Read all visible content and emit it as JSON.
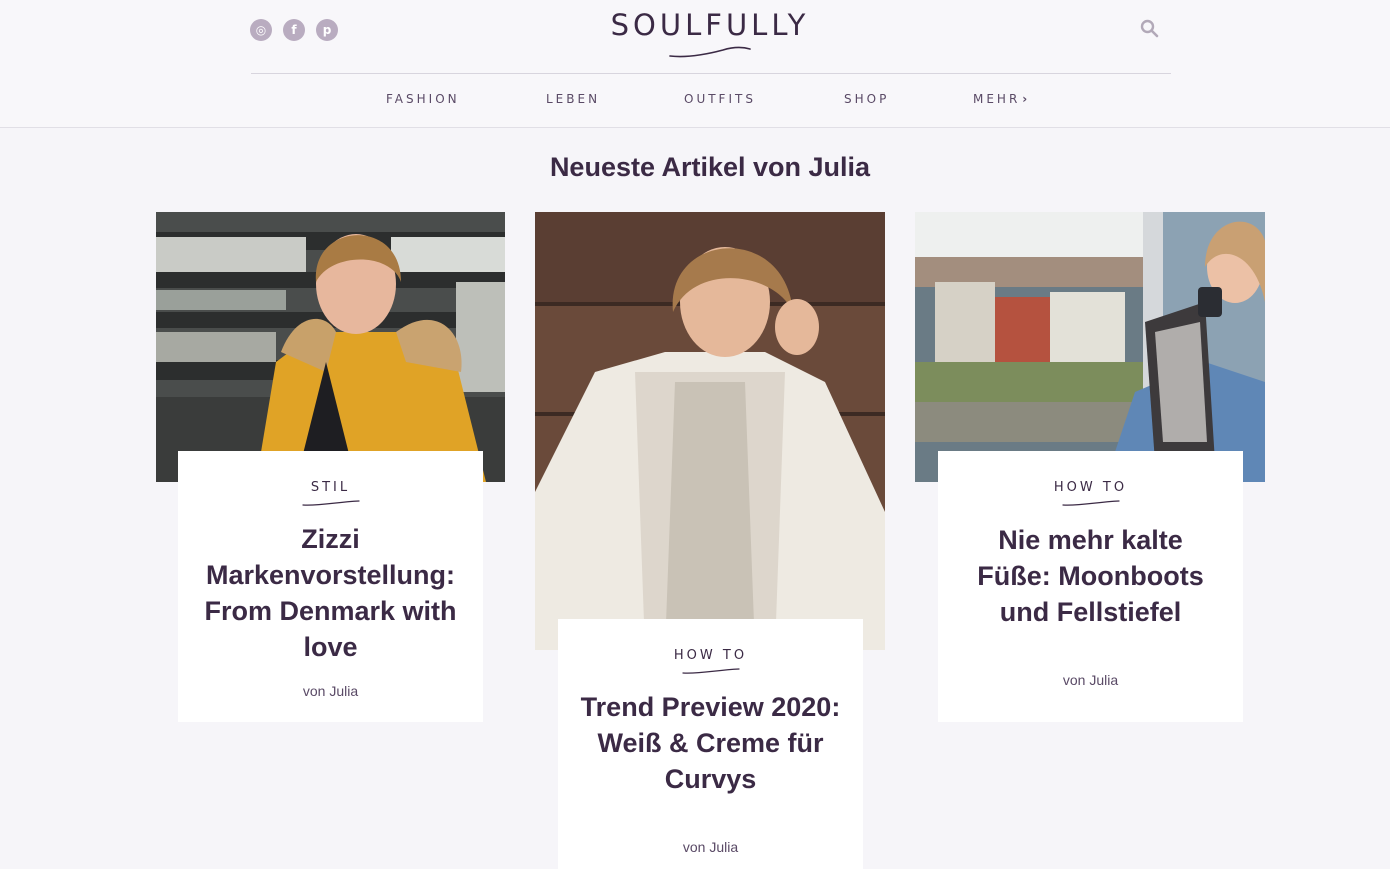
{
  "header": {
    "logo": "SOULFULLY",
    "social": [
      {
        "icon": "instagram-icon",
        "glyph": "◎"
      },
      {
        "icon": "facebook-icon",
        "glyph": "f"
      },
      {
        "icon": "pinterest-icon",
        "glyph": "p"
      }
    ],
    "search_icon": "search-icon"
  },
  "nav": {
    "items": [
      "FASHION",
      "LEBEN",
      "OUTFITS",
      "SHOP",
      "MEHR"
    ]
  },
  "section_title": "Neueste Artikel von Julia",
  "articles": [
    {
      "category": "STIL",
      "title": "Zizzi Markenvorstellung: From Denmark with love",
      "author": "von Julia"
    },
    {
      "category": "HOW TO",
      "title": "Trend Preview 2020: Weiß & Creme für Curvys",
      "author": "von Julia"
    },
    {
      "category": "HOW TO",
      "title": "Nie mehr kalte Füße: Moonboots und Fellstiefel",
      "author": "von Julia"
    }
  ],
  "colors": {
    "accent": "#3b2a45",
    "background": "#f6f5f9",
    "social_icon": "#b9acc0"
  }
}
